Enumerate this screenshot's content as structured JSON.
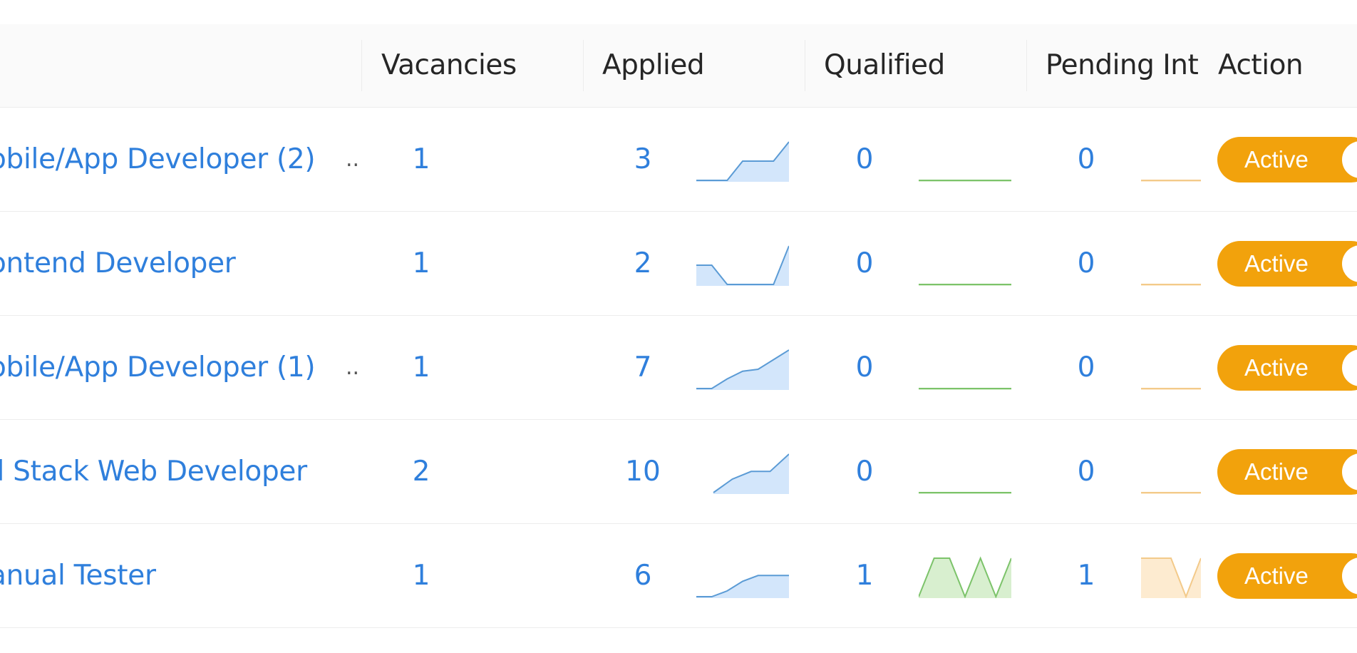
{
  "header": {
    "columns": [
      "Vacancies",
      "Applied",
      "Qualified",
      "Pending Int",
      "Action"
    ]
  },
  "rows": [
    {
      "title": "obile/App Developer (2)",
      "has_ellipsis": true,
      "ellipsis": "..",
      "vacancies": "1",
      "applied": "3",
      "qualified": "0",
      "pending": "0",
      "status": "Active",
      "applied_trend": [
        0,
        0,
        0,
        0.5,
        0.5,
        0.5,
        1
      ],
      "qualified_trend": [
        0,
        0,
        0,
        0,
        0,
        0,
        0
      ],
      "pending_trend": [
        0,
        0,
        0,
        0,
        0,
        0,
        0
      ]
    },
    {
      "title": "ontend Developer",
      "has_ellipsis": false,
      "ellipsis": "",
      "vacancies": "1",
      "applied": "2",
      "qualified": "0",
      "pending": "0",
      "status": "Active",
      "applied_trend": [
        0.5,
        0.5,
        0,
        0,
        0,
        0,
        1
      ],
      "qualified_trend": [
        0,
        0,
        0,
        0,
        0,
        0,
        0
      ],
      "pending_trend": [
        0,
        0,
        0,
        0,
        0,
        0,
        0
      ]
    },
    {
      "title": "obile/App Developer (1)",
      "has_ellipsis": true,
      "ellipsis": "..",
      "vacancies": "1",
      "applied": "7",
      "qualified": "0",
      "pending": "0",
      "status": "Active",
      "applied_trend": [
        0,
        0,
        0.25,
        0.45,
        0.5,
        0.75,
        1
      ],
      "qualified_trend": [
        0,
        0,
        0,
        0,
        0,
        0,
        0
      ],
      "pending_trend": [
        0,
        0,
        0,
        0,
        0,
        0,
        0
      ]
    },
    {
      "title": "ll Stack Web Developer",
      "has_ellipsis": false,
      "ellipsis": "",
      "vacancies": "2",
      "applied": "10",
      "qualified": "0",
      "pending": "0",
      "status": "Active",
      "applied_trend": [
        0,
        0.35,
        0.55,
        0.55,
        1
      ],
      "applied_offset": true,
      "qualified_trend": [
        0,
        0,
        0,
        0,
        0,
        0,
        0
      ],
      "pending_trend": [
        0,
        0,
        0,
        0,
        0,
        0,
        0
      ]
    },
    {
      "title": "anual Tester",
      "has_ellipsis": false,
      "ellipsis": "",
      "vacancies": "1",
      "applied": "6",
      "qualified": "1",
      "pending": "1",
      "status": "Active",
      "applied_trend": [
        0,
        0,
        0.15,
        0.4,
        0.55,
        0.55,
        0.55
      ],
      "qualified_trend": [
        0,
        1,
        1,
        0,
        1,
        0,
        1
      ],
      "pending_trend": [
        1,
        1,
        1,
        0,
        1
      ]
    }
  ],
  "colors": {
    "applied_line": "#5b9bd5",
    "applied_fill": "#d3e6fb",
    "qualified_line": "#7cc36a",
    "qualified_fill": "#d8efcf",
    "pending_line": "#f3ca8a",
    "pending_fill": "#fdebd0",
    "toggle_active": "#f2a20c",
    "link": "#2f7fdc"
  }
}
